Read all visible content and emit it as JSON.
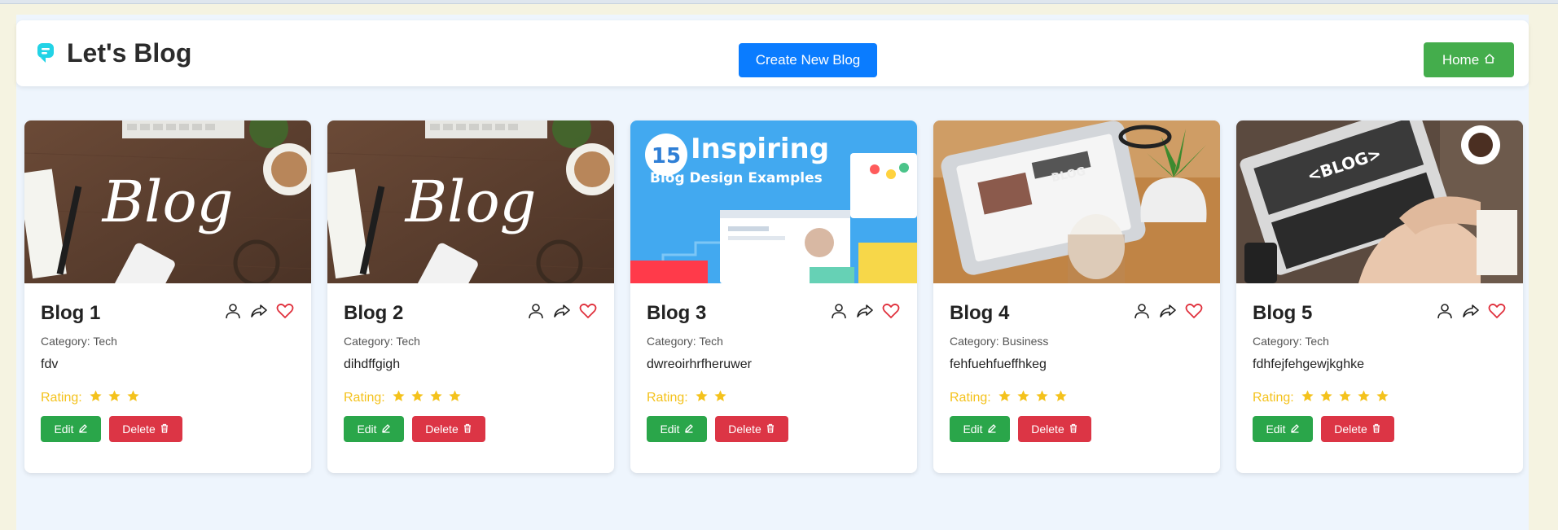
{
  "brand": {
    "title": "Let's Blog",
    "icon": "blog-logo-icon"
  },
  "header": {
    "create_label": "Create New Blog",
    "home_label": "Home"
  },
  "labels": {
    "rating": "Rating:",
    "edit": "Edit",
    "delete": "Delete"
  },
  "colors": {
    "primary": "#0a7cff",
    "home": "#44ad4c",
    "edit": "#2aa64a",
    "delete": "#dc3545",
    "heart": "#e0313d",
    "star": "#f4c21c"
  },
  "blogs": [
    {
      "title": "Blog 1",
      "category": "Category: Tech",
      "description": "fdv",
      "rating": 3,
      "image": "blog-script-desk-photo"
    },
    {
      "title": "Blog 2",
      "category": "Category: Tech",
      "description": "dihdffgigh",
      "rating": 4,
      "image": "blog-script-desk-photo"
    },
    {
      "title": "Blog 3",
      "category": "Category: Tech",
      "description": "dwreoirhrfheruwer",
      "rating": 2,
      "image": "inspiring-blog-design-graphic",
      "image_text": {
        "number": "15",
        "heading": "Inspiring",
        "subheading": "Blog Design Examples"
      }
    },
    {
      "title": "Blog 4",
      "category": "Category: Business",
      "description": "fehfuehfueffhkeg",
      "rating": 4,
      "image": "tablet-coffee-photo"
    },
    {
      "title": "Blog 5",
      "category": "Category: Tech",
      "description": "fdhfejfehgewjkghke",
      "rating": 5,
      "image": "laptop-typing-photo"
    }
  ]
}
